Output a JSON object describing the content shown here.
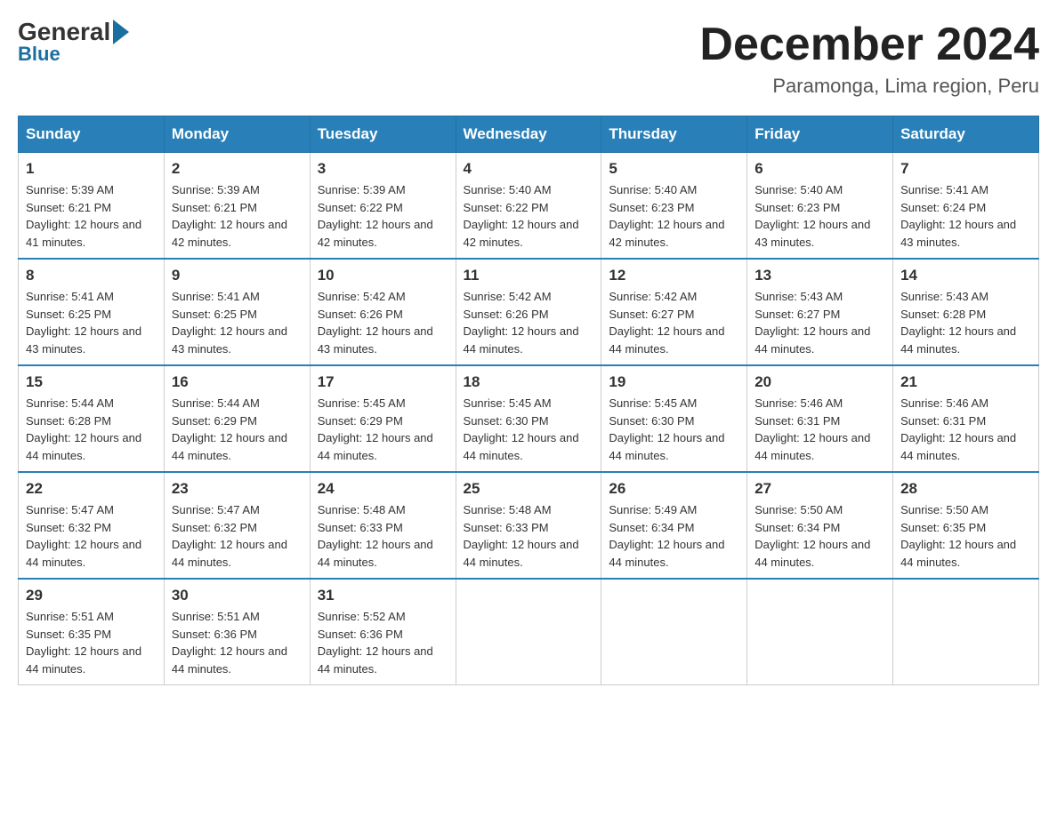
{
  "header": {
    "logo": {
      "general": "General",
      "blue": "Blue"
    },
    "title": "December 2024",
    "location": "Paramonga, Lima region, Peru"
  },
  "weekdays": [
    "Sunday",
    "Monday",
    "Tuesday",
    "Wednesday",
    "Thursday",
    "Friday",
    "Saturday"
  ],
  "weeks": [
    [
      {
        "day": "1",
        "sunrise": "5:39 AM",
        "sunset": "6:21 PM",
        "daylight": "12 hours and 41 minutes."
      },
      {
        "day": "2",
        "sunrise": "5:39 AM",
        "sunset": "6:21 PM",
        "daylight": "12 hours and 42 minutes."
      },
      {
        "day": "3",
        "sunrise": "5:39 AM",
        "sunset": "6:22 PM",
        "daylight": "12 hours and 42 minutes."
      },
      {
        "day": "4",
        "sunrise": "5:40 AM",
        "sunset": "6:22 PM",
        "daylight": "12 hours and 42 minutes."
      },
      {
        "day": "5",
        "sunrise": "5:40 AM",
        "sunset": "6:23 PM",
        "daylight": "12 hours and 42 minutes."
      },
      {
        "day": "6",
        "sunrise": "5:40 AM",
        "sunset": "6:23 PM",
        "daylight": "12 hours and 43 minutes."
      },
      {
        "day": "7",
        "sunrise": "5:41 AM",
        "sunset": "6:24 PM",
        "daylight": "12 hours and 43 minutes."
      }
    ],
    [
      {
        "day": "8",
        "sunrise": "5:41 AM",
        "sunset": "6:25 PM",
        "daylight": "12 hours and 43 minutes."
      },
      {
        "day": "9",
        "sunrise": "5:41 AM",
        "sunset": "6:25 PM",
        "daylight": "12 hours and 43 minutes."
      },
      {
        "day": "10",
        "sunrise": "5:42 AM",
        "sunset": "6:26 PM",
        "daylight": "12 hours and 43 minutes."
      },
      {
        "day": "11",
        "sunrise": "5:42 AM",
        "sunset": "6:26 PM",
        "daylight": "12 hours and 44 minutes."
      },
      {
        "day": "12",
        "sunrise": "5:42 AM",
        "sunset": "6:27 PM",
        "daylight": "12 hours and 44 minutes."
      },
      {
        "day": "13",
        "sunrise": "5:43 AM",
        "sunset": "6:27 PM",
        "daylight": "12 hours and 44 minutes."
      },
      {
        "day": "14",
        "sunrise": "5:43 AM",
        "sunset": "6:28 PM",
        "daylight": "12 hours and 44 minutes."
      }
    ],
    [
      {
        "day": "15",
        "sunrise": "5:44 AM",
        "sunset": "6:28 PM",
        "daylight": "12 hours and 44 minutes."
      },
      {
        "day": "16",
        "sunrise": "5:44 AM",
        "sunset": "6:29 PM",
        "daylight": "12 hours and 44 minutes."
      },
      {
        "day": "17",
        "sunrise": "5:45 AM",
        "sunset": "6:29 PM",
        "daylight": "12 hours and 44 minutes."
      },
      {
        "day": "18",
        "sunrise": "5:45 AM",
        "sunset": "6:30 PM",
        "daylight": "12 hours and 44 minutes."
      },
      {
        "day": "19",
        "sunrise": "5:45 AM",
        "sunset": "6:30 PM",
        "daylight": "12 hours and 44 minutes."
      },
      {
        "day": "20",
        "sunrise": "5:46 AM",
        "sunset": "6:31 PM",
        "daylight": "12 hours and 44 minutes."
      },
      {
        "day": "21",
        "sunrise": "5:46 AM",
        "sunset": "6:31 PM",
        "daylight": "12 hours and 44 minutes."
      }
    ],
    [
      {
        "day": "22",
        "sunrise": "5:47 AM",
        "sunset": "6:32 PM",
        "daylight": "12 hours and 44 minutes."
      },
      {
        "day": "23",
        "sunrise": "5:47 AM",
        "sunset": "6:32 PM",
        "daylight": "12 hours and 44 minutes."
      },
      {
        "day": "24",
        "sunrise": "5:48 AM",
        "sunset": "6:33 PM",
        "daylight": "12 hours and 44 minutes."
      },
      {
        "day": "25",
        "sunrise": "5:48 AM",
        "sunset": "6:33 PM",
        "daylight": "12 hours and 44 minutes."
      },
      {
        "day": "26",
        "sunrise": "5:49 AM",
        "sunset": "6:34 PM",
        "daylight": "12 hours and 44 minutes."
      },
      {
        "day": "27",
        "sunrise": "5:50 AM",
        "sunset": "6:34 PM",
        "daylight": "12 hours and 44 minutes."
      },
      {
        "day": "28",
        "sunrise": "5:50 AM",
        "sunset": "6:35 PM",
        "daylight": "12 hours and 44 minutes."
      }
    ],
    [
      {
        "day": "29",
        "sunrise": "5:51 AM",
        "sunset": "6:35 PM",
        "daylight": "12 hours and 44 minutes."
      },
      {
        "day": "30",
        "sunrise": "5:51 AM",
        "sunset": "6:36 PM",
        "daylight": "12 hours and 44 minutes."
      },
      {
        "day": "31",
        "sunrise": "5:52 AM",
        "sunset": "6:36 PM",
        "daylight": "12 hours and 44 minutes."
      },
      null,
      null,
      null,
      null
    ]
  ],
  "labels": {
    "sunrise": "Sunrise:",
    "sunset": "Sunset:",
    "daylight": "Daylight:"
  }
}
